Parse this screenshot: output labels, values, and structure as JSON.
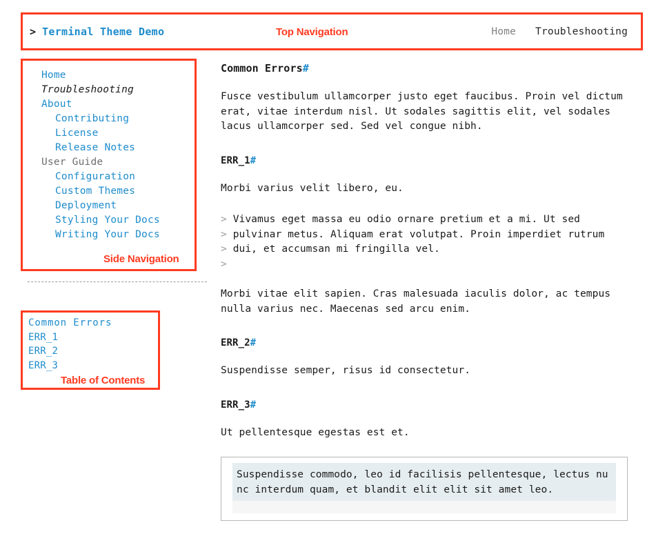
{
  "header": {
    "prompt": ">",
    "title": "Terminal Theme Demo",
    "annotation": "Top Navigation",
    "links": [
      {
        "label": "Home",
        "state": "inactive"
      },
      {
        "label": "Troubleshooting",
        "state": "active"
      }
    ]
  },
  "sidebar": {
    "annotation": "Side Navigation",
    "items": [
      {
        "label": "Home",
        "level": 0,
        "type": "link"
      },
      {
        "label": "Troubleshooting",
        "level": 0,
        "type": "active"
      },
      {
        "label": "About",
        "level": 0,
        "type": "link"
      },
      {
        "label": "Contributing",
        "level": 1,
        "type": "link"
      },
      {
        "label": "License",
        "level": 1,
        "type": "link"
      },
      {
        "label": "Release Notes",
        "level": 1,
        "type": "link"
      },
      {
        "label": "User Guide",
        "level": 0,
        "type": "section"
      },
      {
        "label": "Configuration",
        "level": 1,
        "type": "link"
      },
      {
        "label": "Custom Themes",
        "level": 1,
        "type": "link"
      },
      {
        "label": "Deployment",
        "level": 1,
        "type": "link"
      },
      {
        "label": "Styling Your Docs",
        "level": 1,
        "type": "link"
      },
      {
        "label": "Writing Your Docs",
        "level": 1,
        "type": "link"
      }
    ]
  },
  "toc": {
    "annotation": "Table of Contents",
    "items": [
      {
        "label": "Common Errors",
        "top": true
      },
      {
        "label": "ERR_1",
        "top": false
      },
      {
        "label": "ERR_2",
        "top": false
      },
      {
        "label": "ERR_3",
        "top": false
      }
    ]
  },
  "content": {
    "anchor_symbol": "#",
    "heading": "Common Errors",
    "intro_paragraph": "Fusce vestibulum ullamcorper justo eget faucibus. Proin vel dictum erat, vitae interdum nisl. Ut sodales sagittis elit, vel sodales lacus ullamcorper sed. Sed vel congue nibh.",
    "sections": [
      {
        "heading": "ERR_1",
        "paragraph": "Morbi varius velit libero, eu."
      },
      {
        "heading": "ERR_2",
        "paragraph": "Suspendisse semper, risus id consectetur."
      },
      {
        "heading": "ERR_3",
        "paragraph": "Ut pellentesque egestas est et."
      }
    ],
    "quote_marker": ">",
    "quote_lines": [
      "Vivamus eget massa eu odio ornare pretium et a mi. Ut sed",
      "pulvinar metus. Aliquam erat volutpat. Proin imperdiet rutrum",
      "dui, et accumsan mi fringilla vel.",
      ""
    ],
    "after_quote_paragraph": "Morbi vitae elit sapien. Cras malesuada iaculis dolor, ac tempus nulla varius nec. Maecenas sed arcu enim.",
    "code_lines": [
      "Suspendisse commodo, leo id facilisis pellentesque, lectus nu",
      "nc interdum quam, et blandit elit elit sit amet leo."
    ]
  },
  "colors": {
    "link": "#1e8ccc",
    "annotation": "#ff3b21",
    "muted": "#808080",
    "code_highlight": "#e6edf0"
  }
}
